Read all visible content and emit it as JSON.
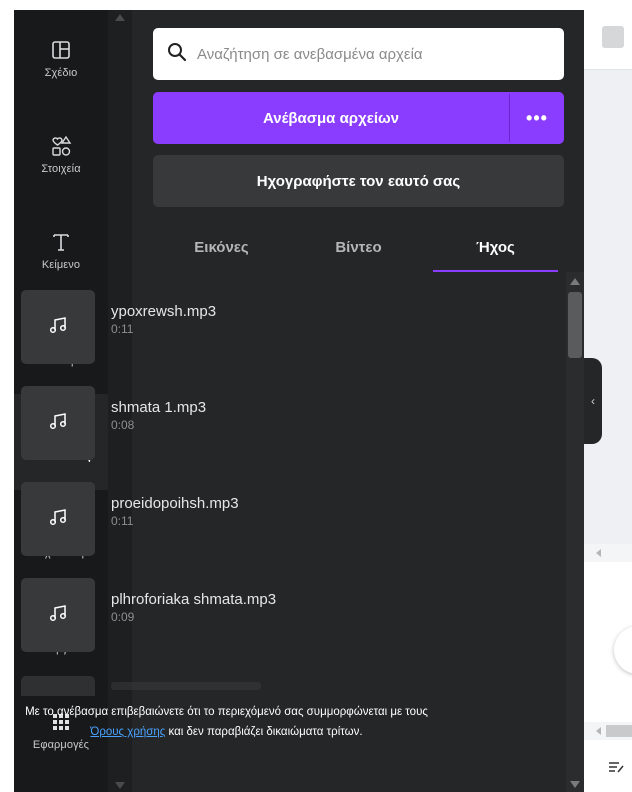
{
  "rail": {
    "items": [
      {
        "label": "Σχέδιο",
        "icon": "layout-icon",
        "active": false
      },
      {
        "label": "Στοιχεία",
        "icon": "elements-icon",
        "active": false
      },
      {
        "label": "Κείμενο",
        "icon": "text-icon",
        "active": false
      },
      {
        "label": "Επωνυμία",
        "icon": "brand-icon",
        "active": false
      },
      {
        "label": "Αποστολές",
        "icon": "upload-cloud-icon",
        "active": true
      },
      {
        "label": "Σχεδίαση",
        "icon": "draw-icon",
        "active": false
      },
      {
        "label": "Έργα",
        "icon": "folder-icon",
        "active": false
      },
      {
        "label": "Εφαρμογές",
        "icon": "apps-grid-icon",
        "active": false
      }
    ]
  },
  "panel": {
    "search": {
      "placeholder": "Αναζήτηση σε ανεβασμένα αρχεία",
      "value": ""
    },
    "upload_label": "Ανέβασμα αρχείων",
    "more_label": "•••",
    "record_label": "Ηχογραφήστε τον εαυτό σας",
    "tabs": [
      {
        "label": "Εικόνες",
        "active": false
      },
      {
        "label": "Βίντεο",
        "active": false
      },
      {
        "label": "Ήχος",
        "active": true
      }
    ],
    "files": [
      {
        "name": "ypoxrewsh.mp3",
        "duration": "0:11"
      },
      {
        "name": "shmata 1.mp3",
        "duration": "0:08"
      },
      {
        "name": "proeidopoihsh.mp3",
        "duration": "0:11"
      },
      {
        "name": "plhroforiaka shmata.mp3",
        "duration": "0:09"
      }
    ],
    "notice": {
      "before": "Με το ανέβασμα επιβεβαιώνετε ότι το περιεχόμενό σας συμμορφώνεται με τους ",
      "link": "Όρους χρήσης",
      "after": " και δεν παραβιάζει δικαιώματα τρίτων."
    }
  },
  "colors": {
    "accent": "#8b3dff",
    "rail_bg": "#18191b",
    "panel_bg": "#252627",
    "link": "#4aa3ff"
  }
}
